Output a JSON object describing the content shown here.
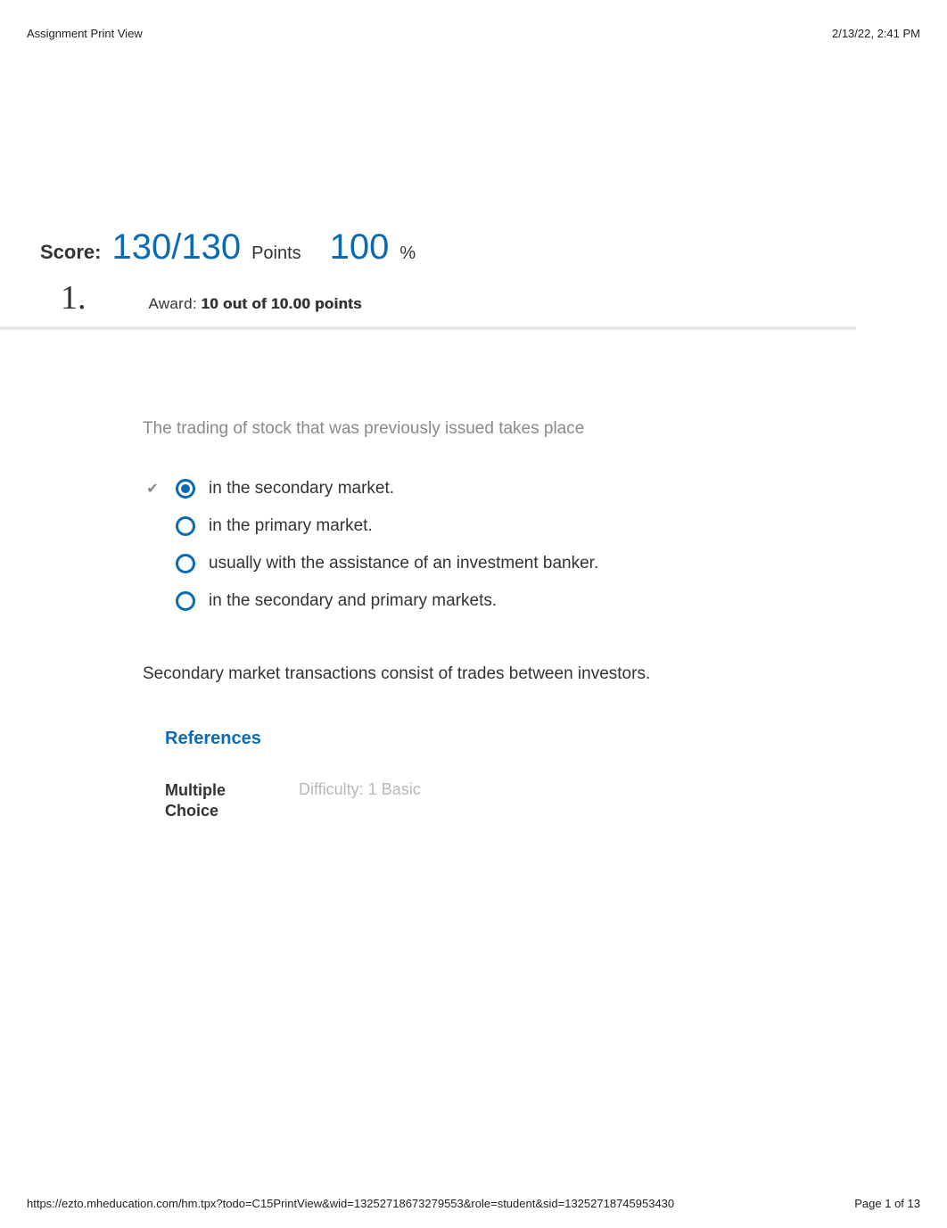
{
  "header": {
    "title": "Assignment Print View",
    "timestamp": "2/13/22, 2:41 PM"
  },
  "score": {
    "label": "Score:",
    "value": "130/130",
    "points_label": "Points",
    "percent": "100",
    "percent_symbol": "%"
  },
  "question": {
    "number": "1.",
    "award_label": "Award:",
    "award_value": "10 out of 10.00 points",
    "text": "The trading of stock that was previously issued takes place",
    "options": [
      {
        "label": "in the secondary market.",
        "selected": true,
        "correct": true
      },
      {
        "label": "in the primary market.",
        "selected": false,
        "correct": false
      },
      {
        "label": "usually with the assistance of an investment banker.",
        "selected": false,
        "correct": false
      },
      {
        "label": "in the secondary and primary markets.",
        "selected": false,
        "correct": false
      }
    ],
    "explanation": "Secondary market transactions consist of trades between investors."
  },
  "references": {
    "heading": "References",
    "type": "Multiple Choice",
    "difficulty": "Difficulty: 1 Basic"
  },
  "footer": {
    "url": "https://ezto.mheducation.com/hm.tpx?todo=C15PrintView&wid=13252718673279553&role=student&sid=13252718745953430",
    "page": "Page 1 of 13"
  }
}
